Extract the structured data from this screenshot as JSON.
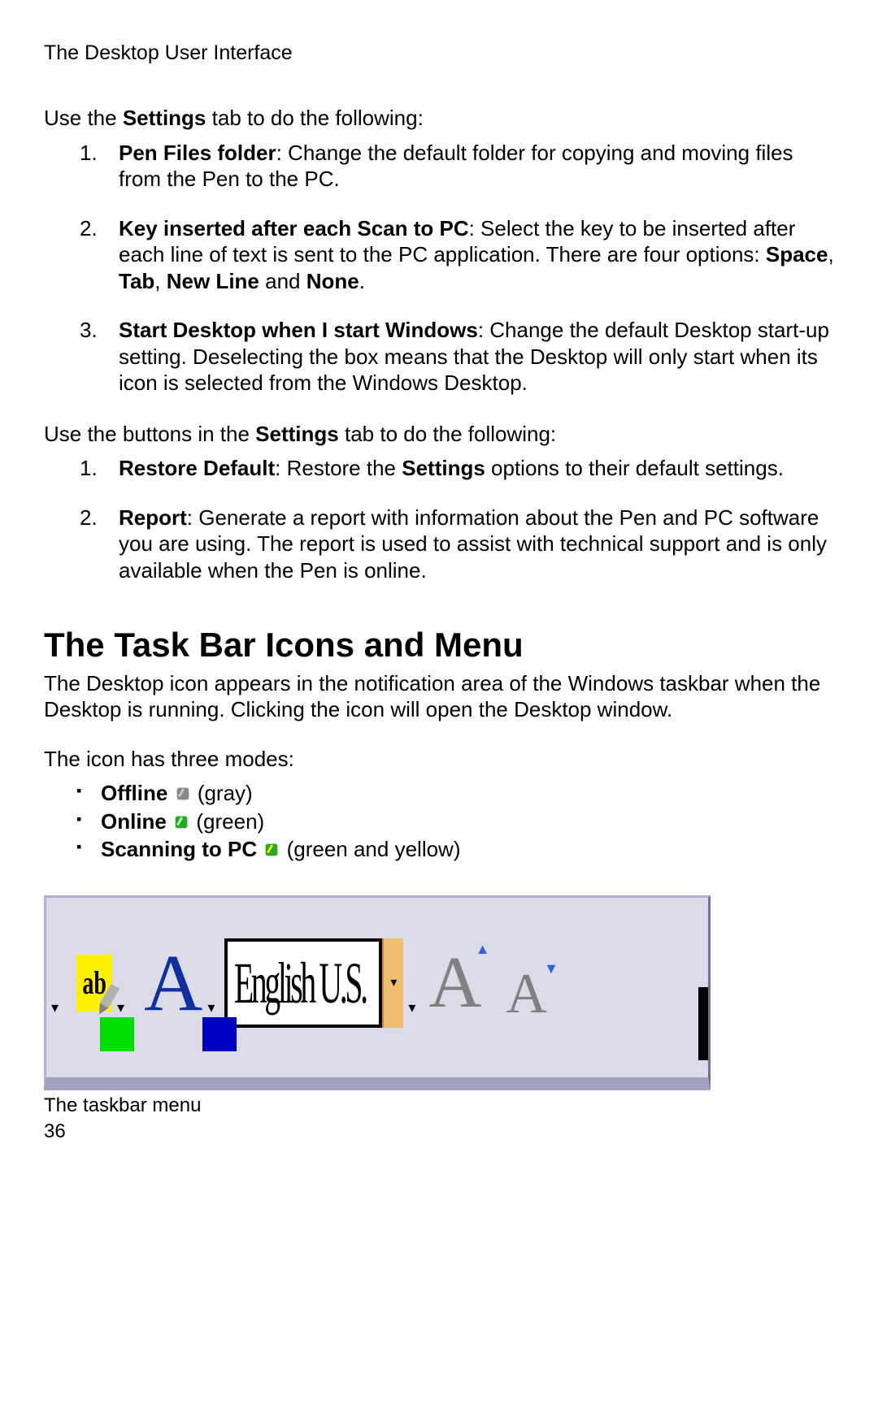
{
  "header": "The Desktop User Interface",
  "intro1_pre": "Use the ",
  "intro1_bold": "Settings",
  "intro1_post": " tab to do the following:",
  "list1": {
    "item1": {
      "num": "1.",
      "bold": "Pen Files folder",
      "text": ": Change the default folder for copying and moving files from the Pen to the PC."
    },
    "item2": {
      "num": "2.",
      "bold1": "Key inserted after each Scan to PC",
      "text1": ": Select the key to be inserted after each line of text is sent to the PC application. There are four options: ",
      "bold2": "Space",
      "sep1": ", ",
      "bold3": "Tab",
      "sep2": ", ",
      "bold4": "New Line",
      "sep3": " and ",
      "bold5": "None",
      "end": "."
    },
    "item3": {
      "num": "3.",
      "bold": "Start Desktop when I start Windows",
      "text": ": Change the default Desktop start-up setting. Deselecting the box means that the Desktop will only start when its icon is selected from the Windows Desktop."
    }
  },
  "intro2_pre": "Use the buttons in the ",
  "intro2_bold": "Settings",
  "intro2_post": " tab to do the following:",
  "list2": {
    "item1": {
      "num": "1.",
      "bold1": "Restore Default",
      "text1": ": Restore the ",
      "bold2": "Settings",
      "text2": " options to their default settings."
    },
    "item2": {
      "num": "2.",
      "bold": "Report",
      "text": ": Generate a report with information about the Pen and PC software you are using. The report is used to assist with technical support and is only available when the Pen is online."
    }
  },
  "section_heading": "The Task Bar Icons and Menu",
  "section_body": "The Desktop icon appears in the notification area of the Windows taskbar when the Desktop is running. Clicking the icon will open the Desktop window.",
  "modes_intro": "The icon has three modes:",
  "modes": {
    "m1": {
      "bold": "Offline",
      "paren": " (gray)"
    },
    "m2": {
      "bold": "Online",
      "paren": " (green)"
    },
    "m3": {
      "bold": "Scanning to PC",
      "paren": " (green and yellow)"
    }
  },
  "figure": {
    "ab": "ab",
    "A": "A",
    "lang": "English U.S.",
    "down": "▾"
  },
  "caption": "The taskbar menu",
  "page": "36"
}
